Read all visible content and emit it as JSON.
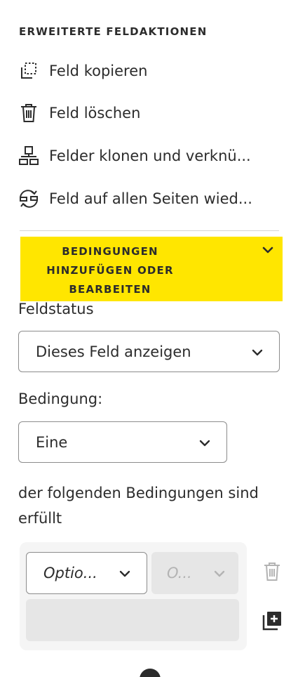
{
  "advanced": {
    "title": "ERWEITERTE FELDAKTIONEN",
    "actions": [
      {
        "label": "Feld kopieren",
        "icon": "copy-field-icon"
      },
      {
        "label": "Feld löschen",
        "icon": "trash-icon"
      },
      {
        "label": "Felder klonen und verknü...",
        "icon": "clone-link-icon"
      },
      {
        "label": "Feld auf allen Seiten wied...",
        "icon": "repeat-pages-icon"
      }
    ]
  },
  "conditions": {
    "title": "BEDINGUNGEN HINZUFÜGEN ODER BEARBEITEN",
    "title_lines": [
      "BEDINGUNGEN",
      "HINZUFÜGEN ODER",
      "BEARBEITEN"
    ],
    "highlight_color": "#ffe600",
    "field_status_label": "Feldstatus",
    "field_status_value": "Dieses Feld anzeigen",
    "condition_label": "Bedingung:",
    "condition_value": "Eine",
    "condition_text": "der folgenden Bedingungen sind erfüllt",
    "condition_text_lines": [
      "der folgenden Bedingungen sind",
      "erfüllt"
    ],
    "row": {
      "option_value": "Optio...",
      "operator_value": "O..."
    }
  }
}
